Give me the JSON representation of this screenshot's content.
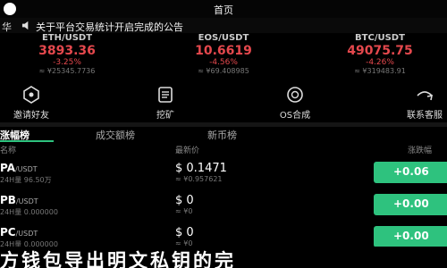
{
  "header": {
    "title": "首页"
  },
  "notice": {
    "label": "华",
    "text": "关于平台交易统计开启完成的公告"
  },
  "tickers": [
    {
      "pair": "ETH/USDT",
      "price": "3893.36",
      "change": "-3.25%",
      "volume": "≈ ¥25345.7736"
    },
    {
      "pair": "EOS/USDT",
      "price": "10.6619",
      "change": "-4.56%",
      "volume": "≈ ¥69.408985"
    },
    {
      "pair": "BTC/USDT",
      "price": "49075.75",
      "change": "-4.26%",
      "volume": "≈ ¥319483.91"
    }
  ],
  "menu": [
    {
      "icon": "invite-icon",
      "label": "邀请好友"
    },
    {
      "icon": "mining-icon",
      "label": "挖矿"
    },
    {
      "icon": "os-contract-icon",
      "label": "OS合成"
    },
    {
      "icon": "contact-service-icon",
      "label": "联系客服"
    }
  ],
  "tabs": [
    "涨幅榜",
    "成交额榜",
    "新币榜"
  ],
  "table": {
    "headers": {
      "name": "名称",
      "price": "最新价",
      "change": "涨跌幅"
    },
    "rows": [
      {
        "symbol": "PA",
        "quote": "/USDT",
        "volume": "24H量 96.50万",
        "price": "$ 0.1471",
        "cny": "≈ ¥0.957621",
        "change": "+0.06"
      },
      {
        "symbol": "PB",
        "quote": "/USDT",
        "volume": "24H量 0.000000",
        "price": "$ 0",
        "cny": "≈ ¥0",
        "change": "+0.00"
      },
      {
        "symbol": "PC",
        "quote": "/USDT",
        "volume": "24H量 0.000000",
        "price": "$ 0",
        "cny": "≈ ¥0",
        "change": "+0.00"
      }
    ]
  },
  "overlay_text": "方钱包导出明文私钥的完",
  "colors": {
    "down": "#e5484d",
    "up": "#2ec27e",
    "background": "#000000"
  }
}
